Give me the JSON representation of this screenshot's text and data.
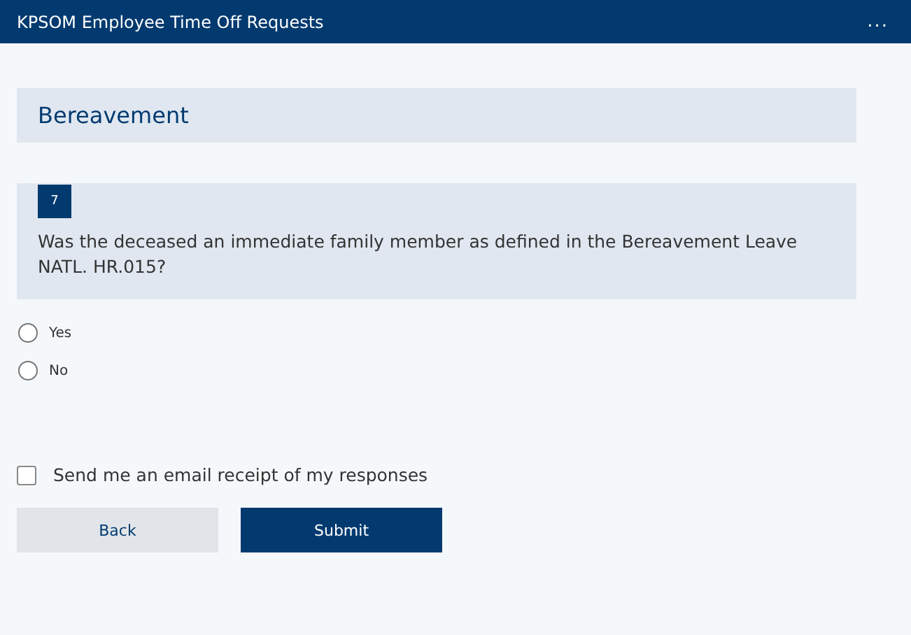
{
  "header": {
    "title": "KPSOM Employee Time Off Requests",
    "menu": "..."
  },
  "section": {
    "title": "Bereavement"
  },
  "question": {
    "number": "7",
    "text": "Was the deceased an immediate family member as defined in the Bereavement Leave NATL. HR.015?",
    "options": [
      {
        "label": "Yes",
        "selected": false
      },
      {
        "label": "No",
        "selected": false
      }
    ]
  },
  "receipt": {
    "label": "Send me an email receipt of my responses",
    "checked": false
  },
  "buttons": [
    {
      "label": "Back",
      "kind": "secondary"
    },
    {
      "label": "Submit",
      "kind": "primary"
    }
  ]
}
